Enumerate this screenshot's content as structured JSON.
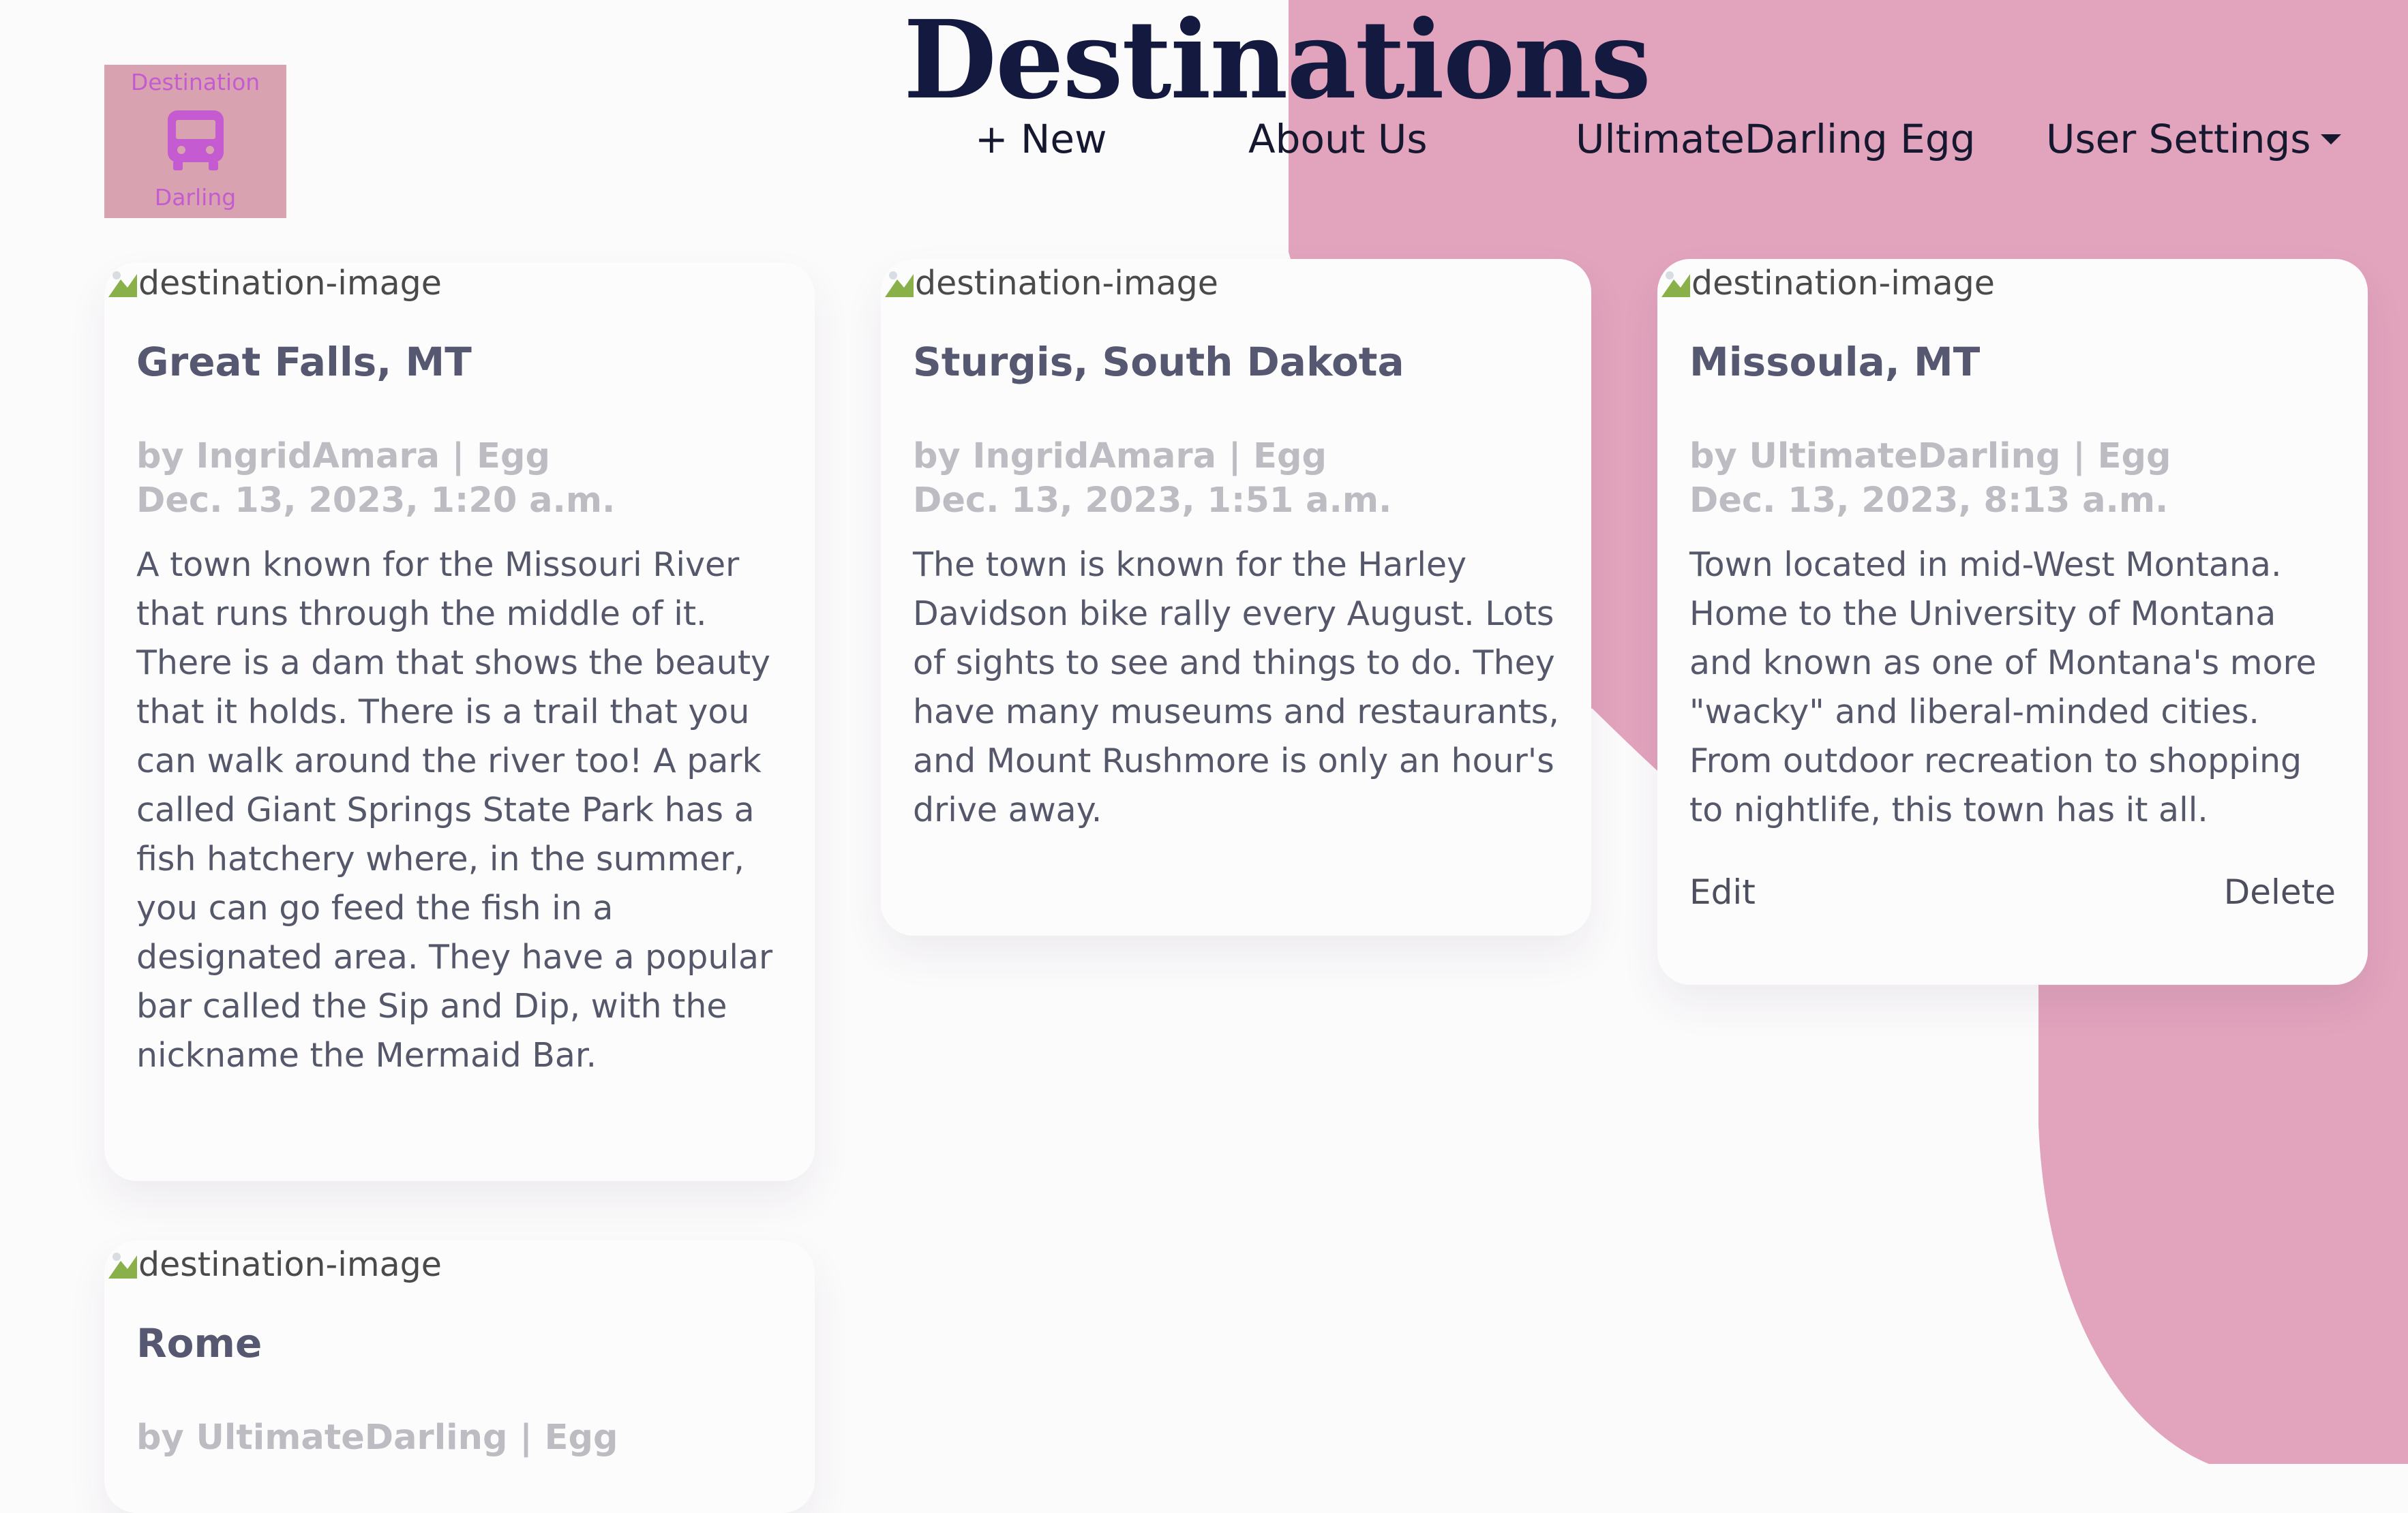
{
  "header": {
    "title": "Destinations",
    "logo": {
      "top_text": "Destination",
      "bottom_text": "Darling",
      "icon": "bus-icon"
    },
    "nav": {
      "new_label": "+ New",
      "about_label": "About Us",
      "user_label": "UltimateDarling Egg",
      "settings_label": "User Settings"
    }
  },
  "colors": {
    "background": "#fcfbfc",
    "accent_blob": "#e2a3bd",
    "logo_bg": "#d9a2b0",
    "logo_text": "#c55bd0",
    "title": "#141a3f"
  },
  "cards": [
    {
      "image_alt": "destination-image",
      "title": "Great Falls, MT",
      "byline": "by IngridAmara | Egg",
      "date": "Dec. 13, 2023, 1:20 a.m.",
      "description": "A town known for the Missouri River that runs through the middle of it. There is a dam that shows the beauty that it holds. There is a trail that you can walk around the river too! A park called Giant Springs State Park has a fish hatchery where, in the summer, you can go feed the fish in a designated area. They have a popular bar called the Sip and Dip, with the nickname the Mermaid Bar."
    },
    {
      "image_alt": "destination-image",
      "title": "Sturgis, South Dakota",
      "byline": "by IngridAmara | Egg",
      "date": "Dec. 13, 2023, 1:51 a.m.",
      "description": "The town is known for the Harley Davidson bike rally every August. Lots of sights to see and things to do. They have many museums and restaurants, and Mount Rushmore is only an hour's drive away."
    },
    {
      "image_alt": "destination-image",
      "title": "Missoula, MT",
      "byline": "by UltimateDarling | Egg",
      "date": "Dec. 13, 2023, 8:13 a.m.",
      "description": "Town located in mid-West Montana. Home to the University of Montana and known as one of Montana's more \"wacky\" and liberal-minded cities. From outdoor recreation to shopping to nightlife, this town has it all.",
      "edit_label": "Edit",
      "delete_label": "Delete"
    },
    {
      "image_alt": "destination-image",
      "title": "Rome",
      "byline": "by UltimateDarling | Egg"
    }
  ]
}
